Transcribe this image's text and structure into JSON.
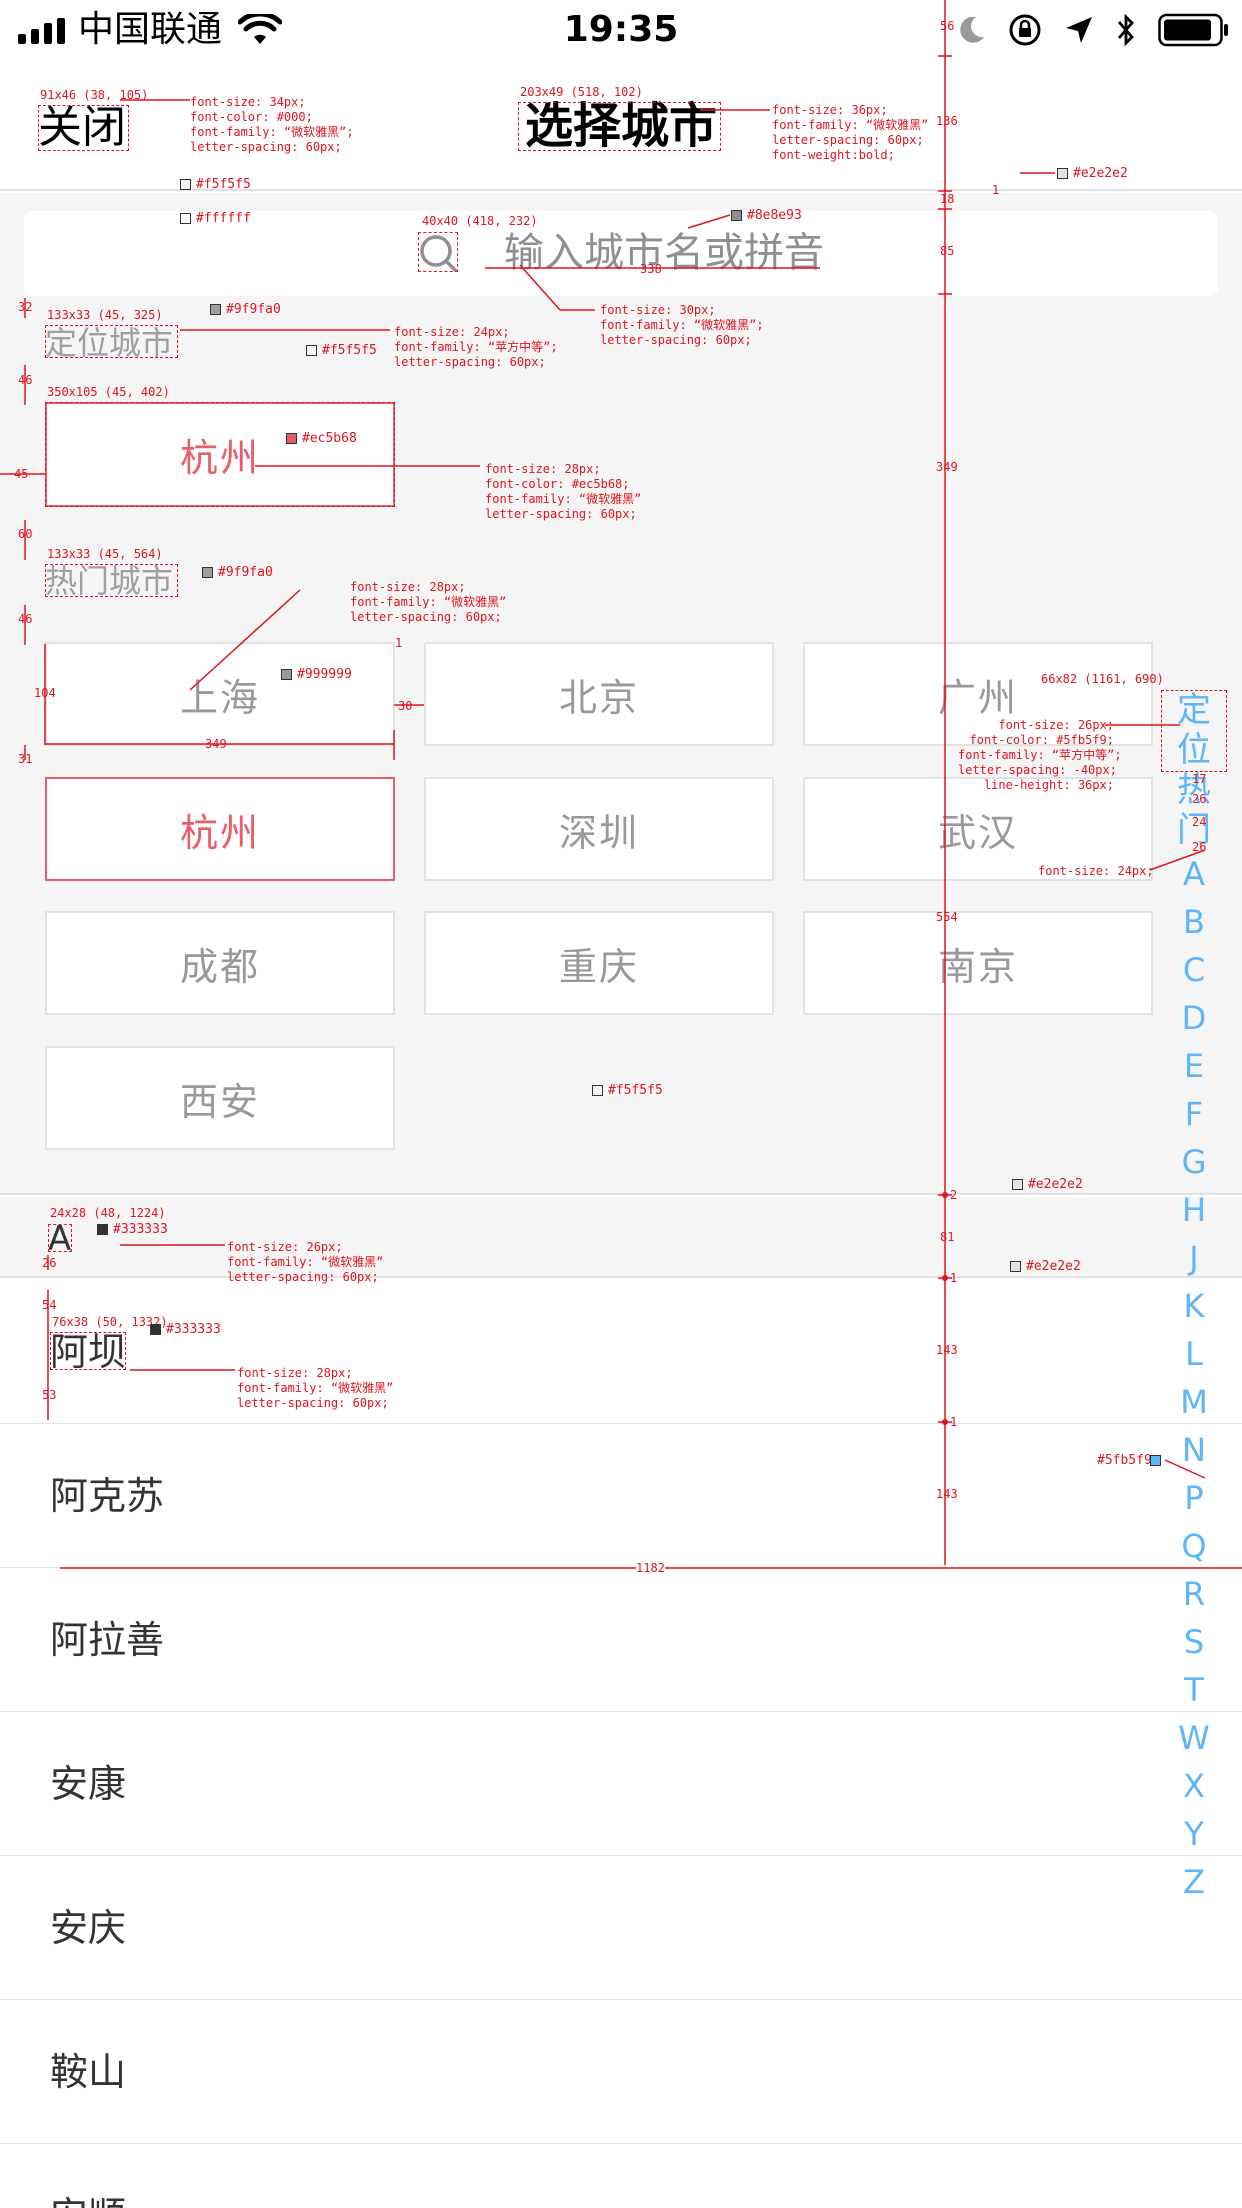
{
  "status_bar": {
    "carrier": "中国联通",
    "time": "19:35"
  },
  "nav": {
    "close_label": "关闭",
    "title": "选择城市"
  },
  "search": {
    "placeholder": "输入城市名或拼音"
  },
  "location_section": {
    "label": "定位城市",
    "city": "杭州"
  },
  "hot_section": {
    "label": "热门城市",
    "cities": [
      "上海",
      "北京",
      "广州",
      "杭州",
      "深圳",
      "武汉",
      "成都",
      "重庆",
      "南京",
      "西安"
    ],
    "active_city": "杭州"
  },
  "list_section": {
    "letter": "A",
    "cities": [
      "阿坝",
      "阿克苏",
      "阿拉善",
      "安康",
      "安庆",
      "鞍山",
      "安顺"
    ]
  },
  "side_index": {
    "top_items": [
      "定位",
      "热门"
    ],
    "letters": [
      "A",
      "B",
      "C",
      "D",
      "E",
      "F",
      "G",
      "H",
      "J",
      "K",
      "L",
      "M",
      "N",
      "P",
      "Q",
      "R",
      "S",
      "T",
      "W",
      "X",
      "Y",
      "Z"
    ]
  },
  "colors": {
    "accent_red": "#ec5b68",
    "index_blue": "#5fb5f9",
    "label_gray": "#9f9fa0",
    "hot_text_gray": "#999999",
    "panel_bg": "#f5f5f5",
    "divider": "#e2e2e2",
    "placeholder_gray": "#8e8e93",
    "list_text": "#333333"
  },
  "annotations": {
    "close_box": "91x46 (38, 105)",
    "close_style": [
      "font-size: 34px;",
      "font-color: #000;",
      "font-family: “微软雅黑”;",
      "letter-spacing: 60px;"
    ],
    "title_box": "203x49 (518, 102)",
    "title_style": [
      "font-size: 36px;",
      "font-family: “微软雅黑”",
      "letter-spacing: 60px;",
      "font-weight:bold;"
    ],
    "c_f5f5f5": "#f5f5f5",
    "c_ffffff": "#ffffff",
    "c_e2e2e2": "#e2e2e2",
    "c_8e8e93": "#8e8e93",
    "c_9f9fa0": "#9f9fa0",
    "c_ec5b68": "#ec5b68",
    "c_999999": "#999999",
    "c_333333": "#333333",
    "c_5fb5f9": "#5fb5f9",
    "search_icon_box": "40x40 (418, 232)",
    "search_style": [
      "font-size: 30px;",
      "font-family: “微软雅黑”;",
      "letter-spacing: 60px;"
    ],
    "loc_label_box": "133x33 (45, 325)",
    "loc_label_style": [
      "font-size: 24px;",
      "font-family: “苹方中等”;",
      "letter-spacing: 60px;"
    ],
    "loc_btn_box": "350x105 (45, 402)",
    "loc_btn_style": [
      "font-size: 28px;",
      "font-color: #ec5b68;",
      "font-family: “微软雅黑”",
      "letter-spacing: 60px;"
    ],
    "hot_label_box": "133x33 (45, 564)",
    "hot_label_style": [
      "font-size: 28px;",
      "font-family: “微软雅黑”",
      "letter-spacing: 60px;"
    ],
    "index_box": "66x82 (1161, 690)",
    "index_style": [
      "font-size: 26px;",
      "font-color: #5fb5f9;",
      "font-family: “苹方中等”;",
      "letter-spacing: -40px;",
      "line-height: 36px;"
    ],
    "index_letter_style": "font-size: 24px;",
    "letter_box": "24x28 (48, 1224)",
    "letter_style": [
      "font-size: 26px;",
      "font-family: “微软雅黑”",
      "letter-spacing: 60px;"
    ],
    "item_box": "76x38 (50, 1332)",
    "item_style": [
      "font-size: 28px;",
      "font-family: “微软雅黑”",
      "letter-spacing: 60px;"
    ],
    "dims": {
      "d56": "56",
      "d136": "136",
      "d18": "18",
      "d85": "85",
      "d349": "349",
      "d554": "554",
      "d2": "2",
      "d81": "81",
      "d1": "1",
      "d143": "143",
      "d1182": "1182",
      "d338": "338",
      "d32": "32",
      "d46": "46",
      "d45": "45",
      "d60": "60",
      "d104": "104",
      "d30": "30",
      "d31": "31",
      "d26": "26",
      "d54": "54",
      "d53": "53",
      "d17": "17",
      "d24": "24"
    }
  }
}
